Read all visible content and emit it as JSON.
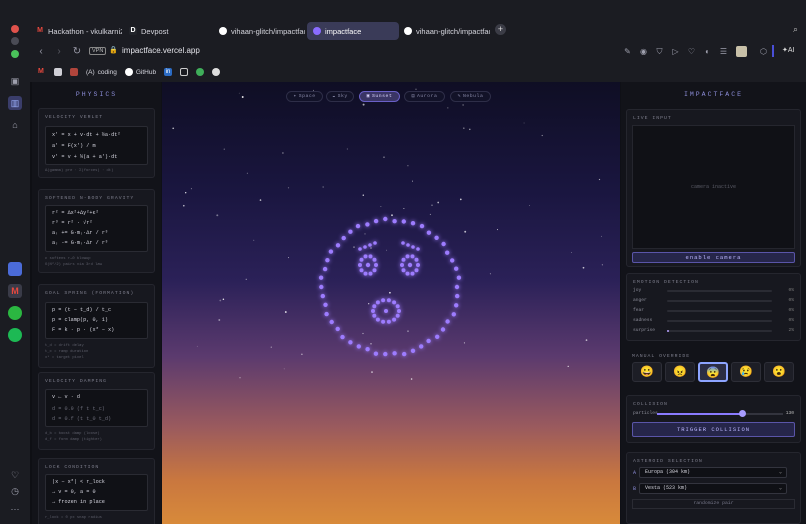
{
  "browser": {
    "tabs": [
      {
        "label": "Hackathon - vkulkarni28",
        "icon": "gmail-icon",
        "active": false
      },
      {
        "label": "Devpost",
        "icon": "devpost-icon",
        "active": false
      },
      {
        "label": "vihaan-glitch/impactface",
        "icon": "github-icon",
        "active": false
      },
      {
        "label": "impactface",
        "icon": "impactface-icon",
        "active": true
      },
      {
        "label": "vihaan-glitch/impactface",
        "icon": "github-icon",
        "active": false
      }
    ],
    "url": "impactface.vercel.app",
    "vpn_label": "VPN",
    "ai_label": "AI",
    "bookmarks": [
      {
        "label": "",
        "icon": "gmail-icon"
      },
      {
        "label": "",
        "icon": "app-icon"
      },
      {
        "label": "",
        "icon": "app-icon"
      },
      {
        "label": "coding",
        "icon": "coding-icon",
        "prefix": "(A)"
      },
      {
        "label": "GitHub",
        "icon": "github-icon"
      },
      {
        "label": "",
        "icon": "linkedin-icon"
      }
    ]
  },
  "left_panel": {
    "title": "PHYSICS",
    "cards": [
      {
        "title": "VELOCITY VERLET",
        "lines": [
          "x' = x + v·dt + ½a·dt²",
          "a' = F(x') / m",
          "v' = v + ½(a + a')·dt"
        ],
        "notes": [
          "Δ(gamma) pre · Σ(forces) · dt)"
        ]
      },
      {
        "title": "SOFTENED N-BODY GRAVITY",
        "lines": [
          "r² = Δx²+Δy²+ε²",
          "r³ = r² · √r²",
          "aᵢ += G·mⱼ·Δr / r³",
          "aⱼ -= G·mᵢ·Δr / r³"
        ],
        "notes": [
          "ε softens r→0 blowup",
          "O(N²/2) pairs via 3rd law"
        ]
      },
      {
        "title": "GOAL SPRING (FORMATION)",
        "lines": [
          "p = (t − t_d) / t_c",
          "p = clamp(p, 0, 1)",
          "F = k · p · (x* − x)"
        ],
        "notes": [
          "t_d = drift delay",
          "t_c = ramp duration",
          "x* = target pixel"
        ]
      },
      {
        "title": "VELOCITY DAMPING",
        "lines": [
          "v ← v · d",
          "d = 0.9 (f t t_c)",
          "d = 0.f (t t_0 t_d)"
        ],
        "notes": [
          "d_b = boost damp (loose)",
          "d_f = form damp (tighter)"
        ]
      },
      {
        "title": "LOCK CONDITION",
        "lines": [
          "|x − x*| < r_lock",
          "→ v = 0, a = 0",
          "→ frozen in place"
        ],
        "notes": [
          "r_lock = 0 px snap radius"
        ]
      }
    ]
  },
  "stage": {
    "toolbar": [
      {
        "label": "Space",
        "icon": "space-icon",
        "active": false
      },
      {
        "label": "Sky",
        "icon": "sky-icon",
        "active": false
      },
      {
        "label": "Sunset",
        "icon": "sunset-icon",
        "active": true
      },
      {
        "label": "Aurora",
        "icon": "aurora-icon",
        "active": false
      },
      {
        "label": "Nebula",
        "icon": "nebula-icon",
        "active": false
      }
    ]
  },
  "right_panel": {
    "title": "IMPACTFACE",
    "live_input": {
      "title": "LIVE INPUT",
      "placeholder": "camera inactive",
      "button": "enable camera"
    },
    "emotion": {
      "title": "EMOTION DETECTION",
      "rows": [
        {
          "label": "joy",
          "value": 0,
          "pct": "0%"
        },
        {
          "label": "anger",
          "value": 0,
          "pct": "0%"
        },
        {
          "label": "fear",
          "value": 0,
          "pct": "0%"
        },
        {
          "label": "sadness",
          "value": 0,
          "pct": "0%"
        },
        {
          "label": "surprise",
          "value": 0.02,
          "pct": "2%"
        }
      ]
    },
    "override": {
      "title": "MANUAL OVERRIDE",
      "options": [
        {
          "emoji": "😀",
          "name": "joy-emoji-icon",
          "active": false
        },
        {
          "emoji": "😠",
          "name": "anger-emoji-icon",
          "active": false
        },
        {
          "emoji": "😨",
          "name": "fear-emoji-icon",
          "active": true
        },
        {
          "emoji": "😢",
          "name": "sadness-emoji-icon",
          "active": false
        },
        {
          "emoji": "😮",
          "name": "surprise-emoji-icon",
          "active": false
        }
      ]
    },
    "collision": {
      "title": "COLLISION",
      "slider_label": "particles",
      "slider_value": "130",
      "slider_fraction": 0.68,
      "button": "TRIGGER COLLISION"
    },
    "asteroid": {
      "title": "ASTEROID SELECTION",
      "a_label": "A",
      "a_value": "Europa (304 km)",
      "b_label": "B",
      "b_value": "Vesta (523 km)",
      "randomize": "randomize pair"
    }
  },
  "colors": {
    "accent": "#8c8dd8",
    "particle": "#9d7bff",
    "active_border": "#8da4ff"
  }
}
